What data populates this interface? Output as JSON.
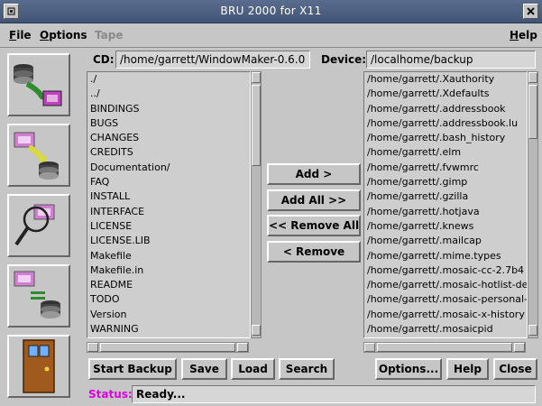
{
  "window": {
    "title": "BRU 2000 for X11"
  },
  "menu": {
    "file_first": "F",
    "file_rest": "ile",
    "options_first": "O",
    "options_rest": "ptions",
    "tape": "Tape",
    "help_first": "H",
    "help_rest": "elp"
  },
  "cd": {
    "label": "CD:",
    "value": "/home/garrett/WindowMaker-0.6.0"
  },
  "device": {
    "label": "Device:",
    "value": "/localhome/backup"
  },
  "left_list": [
    "./",
    "../",
    "BINDINGS",
    "BUGS",
    "CHANGES",
    "CREDITS",
    "Documentation/",
    "FAQ",
    "INSTALL",
    "INTERFACE",
    "LICENSE",
    "LICENSE.LIB",
    "Makefile",
    "Makefile.in",
    "README",
    "TODO",
    "Version",
    "WARNING"
  ],
  "right_list": [
    "/home/garrett/.Xauthority",
    "/home/garrett/.Xdefaults",
    "/home/garrett/.addressbook",
    "/home/garrett/.addressbook.lu",
    "/home/garrett/.bash_history",
    "/home/garrett/.elm",
    "/home/garrett/.fvwmrc",
    "/home/garrett/.gimp",
    "/home/garrett/.gzilla",
    "/home/garrett/.hotjava",
    "/home/garrett/.knews",
    "/home/garrett/.mailcap",
    "/home/garrett/.mime.types",
    "/home/garrett/.mosaic-cc-2.7b4",
    "/home/garrett/.mosaic-hotlist-default",
    "/home/garrett/.mosaic-personal-anno",
    "/home/garrett/.mosaic-x-history",
    "/home/garrett/.mosaicpid"
  ],
  "transfer": {
    "add": "Add >",
    "add_all": "Add All >>",
    "remove_all": "<< Remove All",
    "remove": "< Remove"
  },
  "bottom": {
    "start_backup": "Start Backup",
    "save": "Save",
    "load": "Load",
    "search": "Search",
    "options": "Options...",
    "help": "Help",
    "close": "Close"
  },
  "status": {
    "label": "Status:",
    "value": "Ready..."
  },
  "colors": {
    "titlebar": "#4d5f82",
    "status_label": "#e000e0",
    "face": "#c6c6c6"
  }
}
